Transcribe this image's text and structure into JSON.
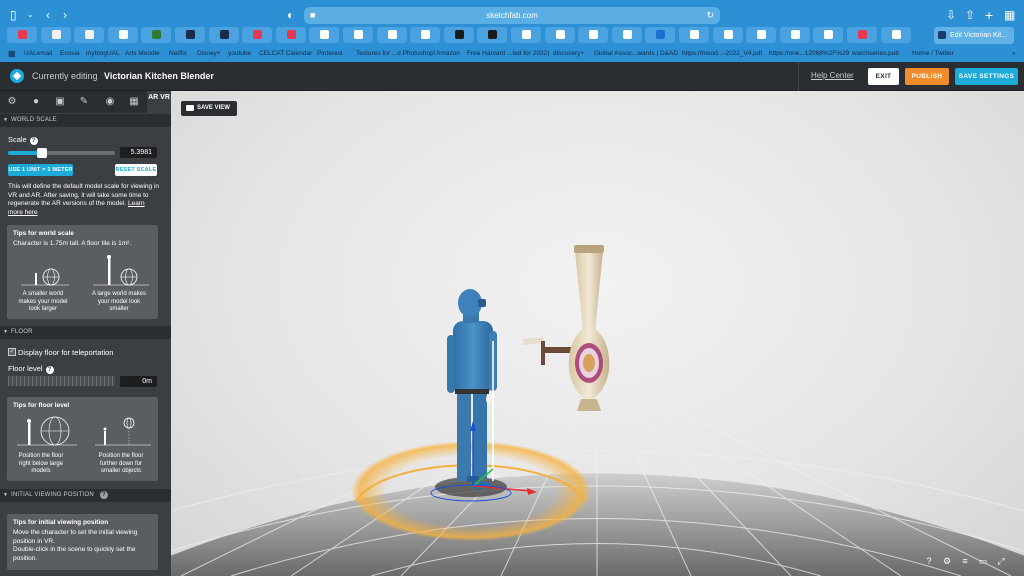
{
  "browser": {
    "url": "sketchfab.com",
    "active_tab_title": "Edit Victorian Kit...",
    "bookmarks": [
      "UALemail",
      "Ecosia",
      "myblogUAL",
      "Arts Moodle",
      "Netflix",
      "Disney+",
      "youtube",
      "CELCAT Calendar",
      "Pinterest",
      "Textures for ...d Photoshop!",
      "Amazon",
      "Free Harvard ...ted for 2022)",
      "discovery+",
      "Global Assoc...wards | D&AD",
      "https://mood...-2022_V4.pdf",
      "https://one...12068%2F%29",
      "watchseries.pub",
      "Home / Twitter"
    ],
    "favicon_colors": [
      "#e8384f",
      "#f2f2f2",
      "#f2f2f2",
      "#ffffff",
      "#2e7d32",
      "#1a2c4a",
      "#1a2c4a",
      "#e8384f",
      "#e8384f",
      "#ffffff",
      "#ffffff",
      "#ffffff",
      "#ffffff",
      "#1a1a1a",
      "#1a1a1a",
      "#ffffff",
      "#ffffff",
      "#ffffff",
      "#ffffff",
      "#1a6fd1",
      "#ffffff",
      "#ffffff",
      "#ffffff",
      "#ffffff",
      "#ffffff",
      "#e8384f",
      "#ffffff"
    ]
  },
  "header": {
    "editing_label": "Currently editing",
    "model_name": "Victorian Kitchen Blender",
    "help_center": "Help Center",
    "exit": "EXIT",
    "publish": "PUBLISH",
    "save_settings": "SAVE SETTINGS"
  },
  "sidebar": {
    "tabs": [
      "gear-icon",
      "bulb-icon",
      "image-icon",
      "brush-icon",
      "pin-icon",
      "film-icon",
      "AR VR"
    ],
    "world_scale": {
      "section_title": "WORLD SCALE",
      "scale_label": "Scale",
      "scale_value": "5.3981",
      "slider_fraction": 0.32,
      "use_button": "USE 1 UNIT = 1 METER",
      "reset_button": "RESET SCALE",
      "description": "This will define the default model scale for viewing in VR and AR. After saving, it will take some time to regenerate the AR versions of the model.",
      "learn_more": "Learn more here",
      "tips_title": "Tips for world scale",
      "tips_text": "Character is 1.75m tall. A floor tile is 1m².",
      "tip_small": "A smaller world makes your model look larger",
      "tip_large": "A large world makes your model look smaller"
    },
    "floor": {
      "section_title": "FLOOR",
      "display_floor": "Display floor for teleportation",
      "floor_level_label": "Floor level",
      "floor_level_value": "0m",
      "tips_title": "Tips for floor level",
      "tip_below": "Position the floor right below large models",
      "tip_further": "Position the floor further down for smaller objects"
    },
    "initial_view": {
      "section_title": "INITIAL VIEWING POSITION",
      "tips_title": "Tips for initial viewing position",
      "tips_text": "Move the character to set the initial viewing position in VR.",
      "tips_text2": "Double-click in the scene to quickly set the position."
    }
  },
  "viewport": {
    "save_view": "SAVE VIEW",
    "icons": [
      "help-icon",
      "settings-icon",
      "layers-icon",
      "vr-icon",
      "fullscreen-icon"
    ],
    "icon_glyphs": [
      "?",
      "⚙",
      "≡",
      "▭",
      "⤢"
    ]
  }
}
